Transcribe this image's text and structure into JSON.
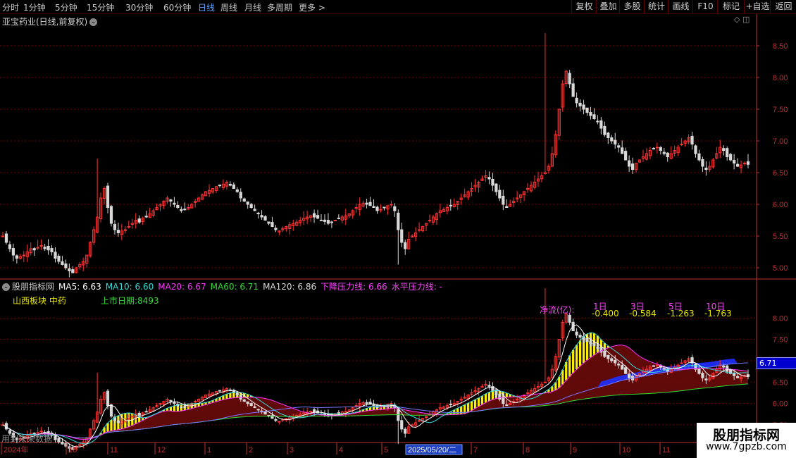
{
  "toolbar": {
    "periods": [
      "分时",
      "1分钟",
      "5分钟",
      "15分钟",
      "30分钟",
      "60分钟",
      "日线",
      "周线",
      "月线",
      "多周期",
      "更多 >"
    ],
    "active_period": "日线",
    "buttons": [
      "复权",
      "叠加",
      "多股",
      "统计",
      "画线",
      "F10",
      "标记",
      "+自选",
      "返回"
    ]
  },
  "stock": {
    "title": "亚宝药业(日线,前复权)"
  },
  "indicator": {
    "name": "股朋指标网",
    "ma5": "MA5: 6.63",
    "ma10": "MA10: 6.60",
    "ma20": "MA20: 6.67",
    "ma60": "MA60: 6.71",
    "ma120": "MA120: 6.86",
    "down_line": "下降压力线: 6.66",
    "flat_line": "水平压力线: -",
    "sector": "山西板块  中药",
    "list_date": "上市日期:8493",
    "current_value": "6.71"
  },
  "flow": {
    "label": "净流(亿):",
    "cols": [
      {
        "period": "1日",
        "value": "-0.400"
      },
      {
        "period": "3日",
        "value": "-0.584"
      },
      {
        "period": "5日",
        "value": "-1.263"
      },
      {
        "period": "10日",
        "value": "-1.763"
      }
    ]
  },
  "watermark": {
    "line1": "股朋指标网",
    "line2": "www.7gpzb.com"
  },
  "future_note": "用到未来数据",
  "colors": {
    "up": "#ff3333",
    "down": "#d8d8d8",
    "ma5": "#ffffff",
    "ma10": "#ffff00",
    "ma20": "#ff33ff",
    "ma60": "#33dd33",
    "ma120": "#7777ff",
    "grid": "#7a0000",
    "axis": "#c03030"
  },
  "chart_data": {
    "type": "candlestick",
    "price_axis_main": {
      "ticks": [
        "8.50",
        "8.00",
        "7.50",
        "7.00",
        "6.50",
        "6.00",
        "5.50",
        "5.00"
      ],
      "range": [
        4.8,
        8.8
      ]
    },
    "price_axis_sub": {
      "ticks": [
        "8.00",
        "7.50",
        "7.00",
        "6.50",
        "6.00",
        "5.50"
      ],
      "range": [
        5.3,
        8.6
      ]
    },
    "x_axis": {
      "labels": [
        "2024年",
        "10",
        "11",
        "12",
        "1",
        "2",
        "3",
        "4",
        "5",
        "2025/05/20/二",
        "7",
        "8",
        "9",
        "10",
        "11"
      ],
      "highlighted": "2025/05/20/二"
    },
    "close_series": [
      5.5,
      5.4,
      5.3,
      5.2,
      5.15,
      5.18,
      5.2,
      5.25,
      5.3,
      5.28,
      5.32,
      5.35,
      5.3,
      5.28,
      5.25,
      5.15,
      5.1,
      5.05,
      5.0,
      4.95,
      4.92,
      5.0,
      5.05,
      5.1,
      5.2,
      5.4,
      5.6,
      5.8,
      6.1,
      6.25,
      5.95,
      5.7,
      5.6,
      5.55,
      5.58,
      5.6,
      5.65,
      5.7,
      5.75,
      5.72,
      5.78,
      5.8,
      5.85,
      5.9,
      5.95,
      6.0,
      6.05,
      6.1,
      6.05,
      6.0,
      5.95,
      5.9,
      5.92,
      5.95,
      6.0,
      6.05,
      6.1,
      6.15,
      6.2,
      6.22,
      6.25,
      6.28,
      6.3,
      6.32,
      6.35,
      6.3,
      6.25,
      6.2,
      6.1,
      6.05,
      6.0,
      5.95,
      5.9,
      5.85,
      5.8,
      5.75,
      5.7,
      5.65,
      5.6,
      5.58,
      5.62,
      5.65,
      5.68,
      5.7,
      5.72,
      5.75,
      5.78,
      5.8,
      5.82,
      5.8,
      5.78,
      5.75,
      5.73,
      5.7,
      5.72,
      5.75,
      5.78,
      5.8,
      5.82,
      5.85,
      5.9,
      5.95,
      6.0,
      6.02,
      6.0,
      5.98,
      5.95,
      5.9,
      5.92,
      5.95,
      5.98,
      6.0,
      5.9,
      5.6,
      5.4,
      5.3,
      5.45,
      5.5,
      5.55,
      5.6,
      5.65,
      5.7,
      5.75,
      5.8,
      5.85,
      5.9,
      5.92,
      5.95,
      5.98,
      6.0,
      6.05,
      6.1,
      6.15,
      6.2,
      6.25,
      6.3,
      6.35,
      6.4,
      6.45,
      6.4,
      6.3,
      6.2,
      6.1,
      6.0,
      5.95,
      6.0,
      6.05,
      6.1,
      6.15,
      6.2,
      6.25,
      6.3,
      6.35,
      6.4,
      6.45,
      6.5,
      6.6,
      6.8,
      7.1,
      7.5,
      7.9,
      8.1,
      7.9,
      7.7,
      7.6,
      7.55,
      7.5,
      7.45,
      7.4,
      7.35,
      7.3,
      7.2,
      7.1,
      7.05,
      7.0,
      6.95,
      6.9,
      6.8,
      6.7,
      6.6,
      6.55,
      6.65,
      6.7,
      6.75,
      6.8,
      6.85,
      6.88,
      6.9,
      6.85,
      6.8,
      6.75,
      6.8,
      6.85,
      6.9,
      6.95,
      7.0,
      7.05,
      6.95,
      6.8,
      6.7,
      6.6,
      6.55,
      6.6,
      6.7,
      6.8,
      6.9,
      6.85,
      6.75,
      6.7,
      6.65,
      6.6,
      6.62,
      6.65,
      6.63
    ]
  }
}
